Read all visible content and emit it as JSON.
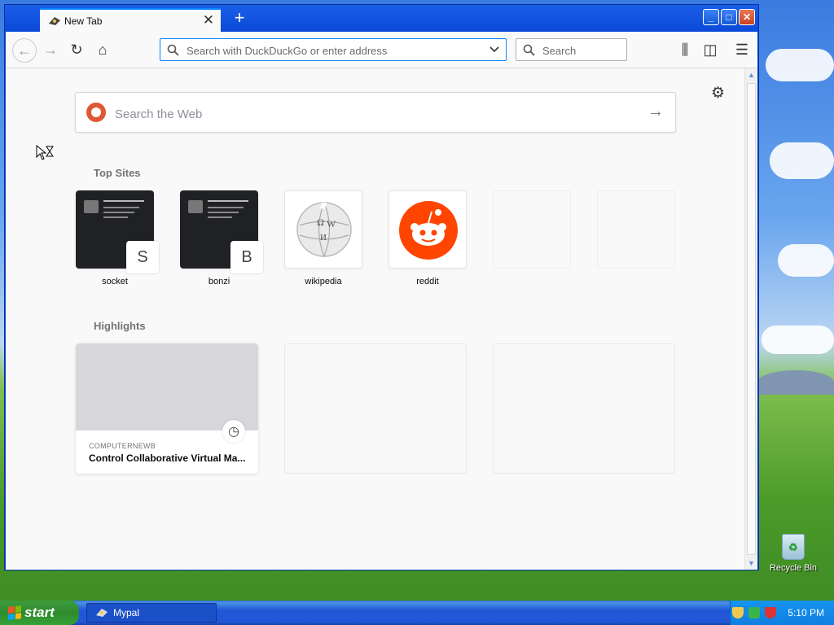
{
  "window": {
    "tab_title": "New Tab",
    "tab_close": "✕",
    "newtab": "+",
    "min": "_",
    "max": "□",
    "close": "✕"
  },
  "navbar": {
    "back": "←",
    "forward": "→",
    "reload": "↻",
    "home": "⌂",
    "url_placeholder": "Search with DuckDuckGo or enter address",
    "url_value": "",
    "search_placeholder": "Search",
    "library": "⫼",
    "sidebar": "◫",
    "menu": "☰"
  },
  "page": {
    "web_search_placeholder": "Search the Web",
    "go": "→",
    "settings": "⚙",
    "top_sites_title": "Top Sites",
    "highlights_title": "Highlights",
    "top_sites": [
      {
        "label": "socket",
        "letter": "S",
        "style": "dark"
      },
      {
        "label": "bonzi",
        "letter": "B",
        "style": "dark"
      },
      {
        "label": "wikipedia",
        "letter": "",
        "style": "wikipedia"
      },
      {
        "label": "reddit",
        "letter": "",
        "style": "reddit"
      },
      {
        "label": "",
        "letter": "",
        "style": "empty"
      },
      {
        "label": "",
        "letter": "",
        "style": "empty"
      }
    ],
    "highlights": [
      {
        "source": "COMPUTERNEWB",
        "title": "Control Collaborative Virtual Ma...",
        "clock": "◷"
      }
    ]
  },
  "desktop": {
    "recycle_bin": "Recycle Bin"
  },
  "taskbar": {
    "start": "start",
    "task_label": "Mypal",
    "clock": "5:10 PM"
  },
  "colors": {
    "accent": "#0a84ff",
    "reddit": "#ff4500",
    "duckduckgo": "#de5833"
  }
}
